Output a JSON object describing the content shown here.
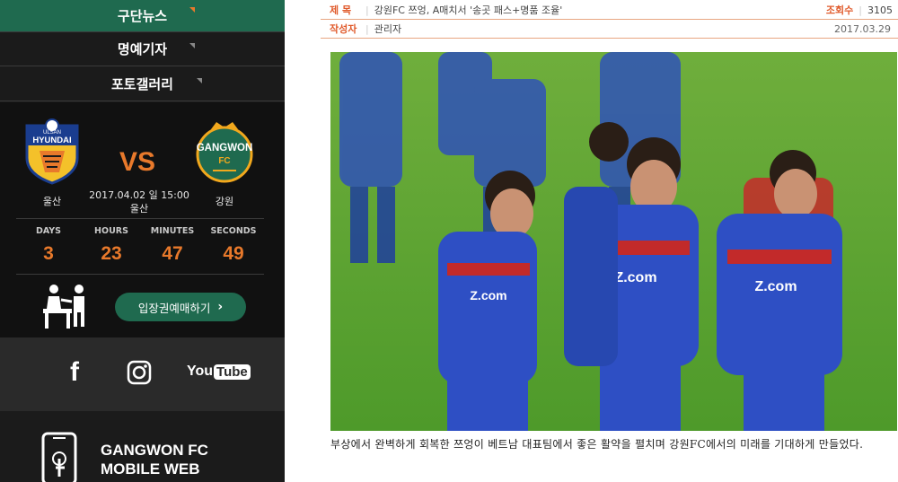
{
  "sidebar": {
    "nav": [
      {
        "label": "구단뉴스",
        "active": true
      },
      {
        "label": "명예기자",
        "active": false
      },
      {
        "label": "포토갤러리",
        "active": false
      }
    ],
    "match": {
      "home": {
        "name": "울산",
        "logo_text": "HYUNDAI",
        "logo_sub": "ULSAN"
      },
      "away": {
        "name": "강원",
        "logo_text": "GANGWON",
        "logo_sub": "FC"
      },
      "vs": "VS",
      "datetime": "2017.04.02 일 15:00",
      "venue": "울산",
      "countdown": [
        {
          "unit": "DAYS",
          "value": "3"
        },
        {
          "unit": "HOURS",
          "value": "23"
        },
        {
          "unit": "MINUTES",
          "value": "47"
        },
        {
          "unit": "SECONDS",
          "value": "49"
        }
      ],
      "ticket_label": "입장권예매하기"
    },
    "social": {
      "facebook": "f",
      "youtube_you": "You",
      "youtube_tube": "Tube"
    },
    "mobile": {
      "line1": "GANGWON FC",
      "line2": "MOBILE WEB"
    }
  },
  "article": {
    "title_key": "제 목",
    "title": "강원FC 쯔엉, A매치서 '송곳 패스+명품 조율'",
    "views_key": "조회수",
    "views": "3105",
    "author_key": "작성자",
    "author": "관리자",
    "date": "2017.03.29",
    "caption": "부상에서 완벽하게 회복한 쯔엉이 베트남 대표팀에서 좋은 활약을 펼치며 강원FC에서의 미래를 기대하게 만들었다.",
    "jersey_text": "Z.com"
  },
  "colors": {
    "accent": "#e8792b",
    "green": "#1f6a4f",
    "sidebar_bg": "#1b1b1b",
    "label_orange": "#e05a2b"
  }
}
